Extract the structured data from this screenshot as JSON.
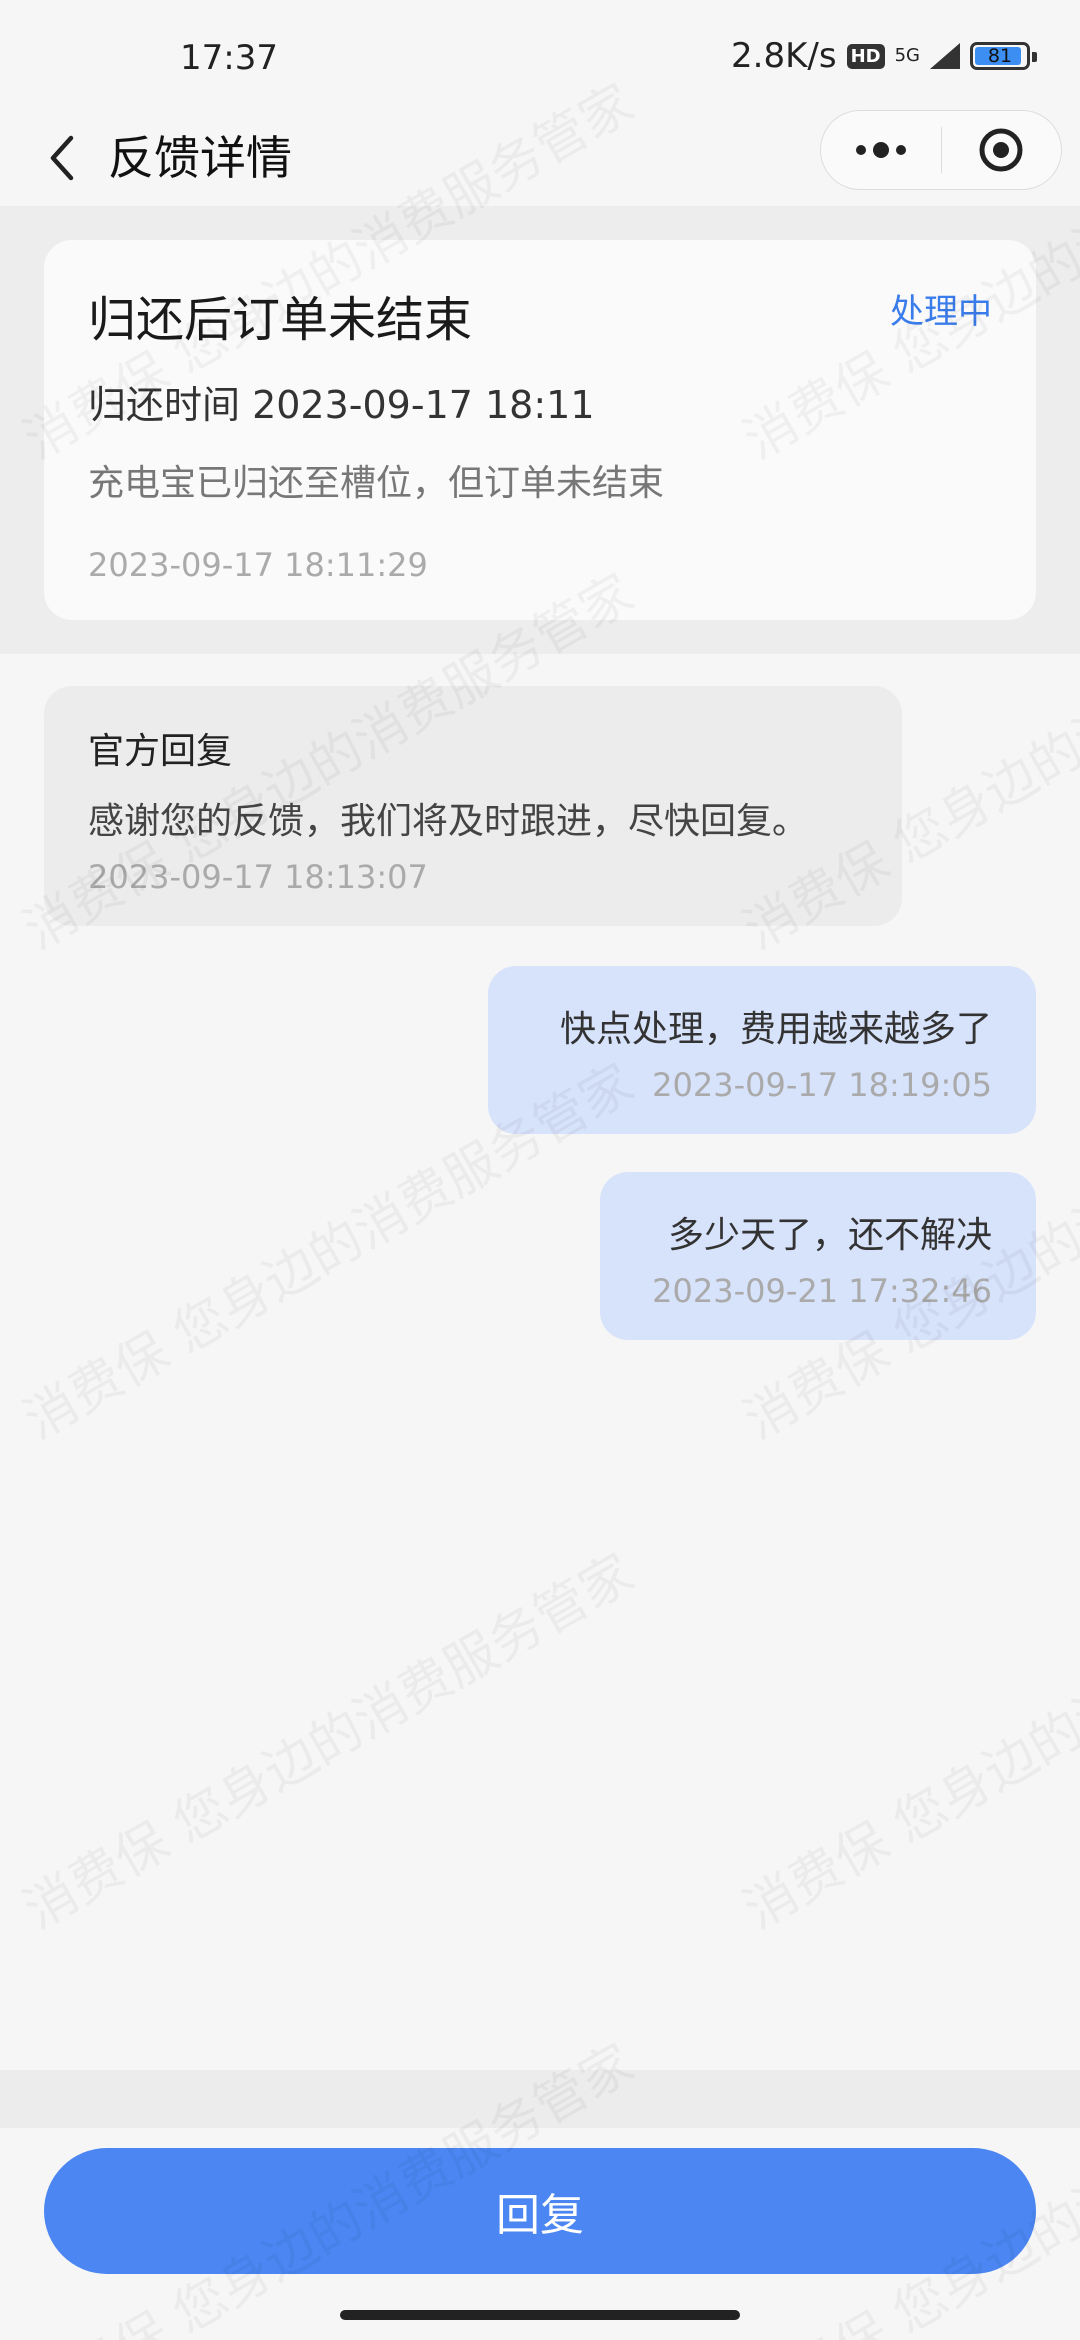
{
  "status_bar": {
    "time": "17:37",
    "net_speed": "2.8K/s",
    "hd": "HD",
    "network": "5G",
    "battery": "81"
  },
  "nav": {
    "title": "反馈详情",
    "back_icon": "chevron-left-icon",
    "more_icon": "more-icon",
    "target_icon": "target-icon"
  },
  "feedback": {
    "title": "归还后订单未结束",
    "status": "处理中",
    "return_time": "归还时间 2023-09-17 18:11",
    "description": "充电宝已归还至槽位，但订单未结束",
    "created": "2023-09-17 18:11:29"
  },
  "messages": [
    {
      "type": "official",
      "label": "官方回复",
      "text": "感谢您的反馈，我们将及时跟进，尽快回复。",
      "time": "2023-09-17 18:13:07"
    },
    {
      "type": "user",
      "text": "快点处理，费用越来越多了",
      "time": "2023-09-17 18:19:05"
    },
    {
      "type": "user",
      "text": "多少天了，还不解决",
      "time": "2023-09-21 17:32:46"
    }
  ],
  "reply_button": "回复",
  "watermark": {
    "line1": "消费保 您身边的消费服务管家"
  },
  "colors": {
    "accent": "#4b86f2",
    "status": "#3a7dea",
    "user_bubble": "#d7e2fb"
  }
}
